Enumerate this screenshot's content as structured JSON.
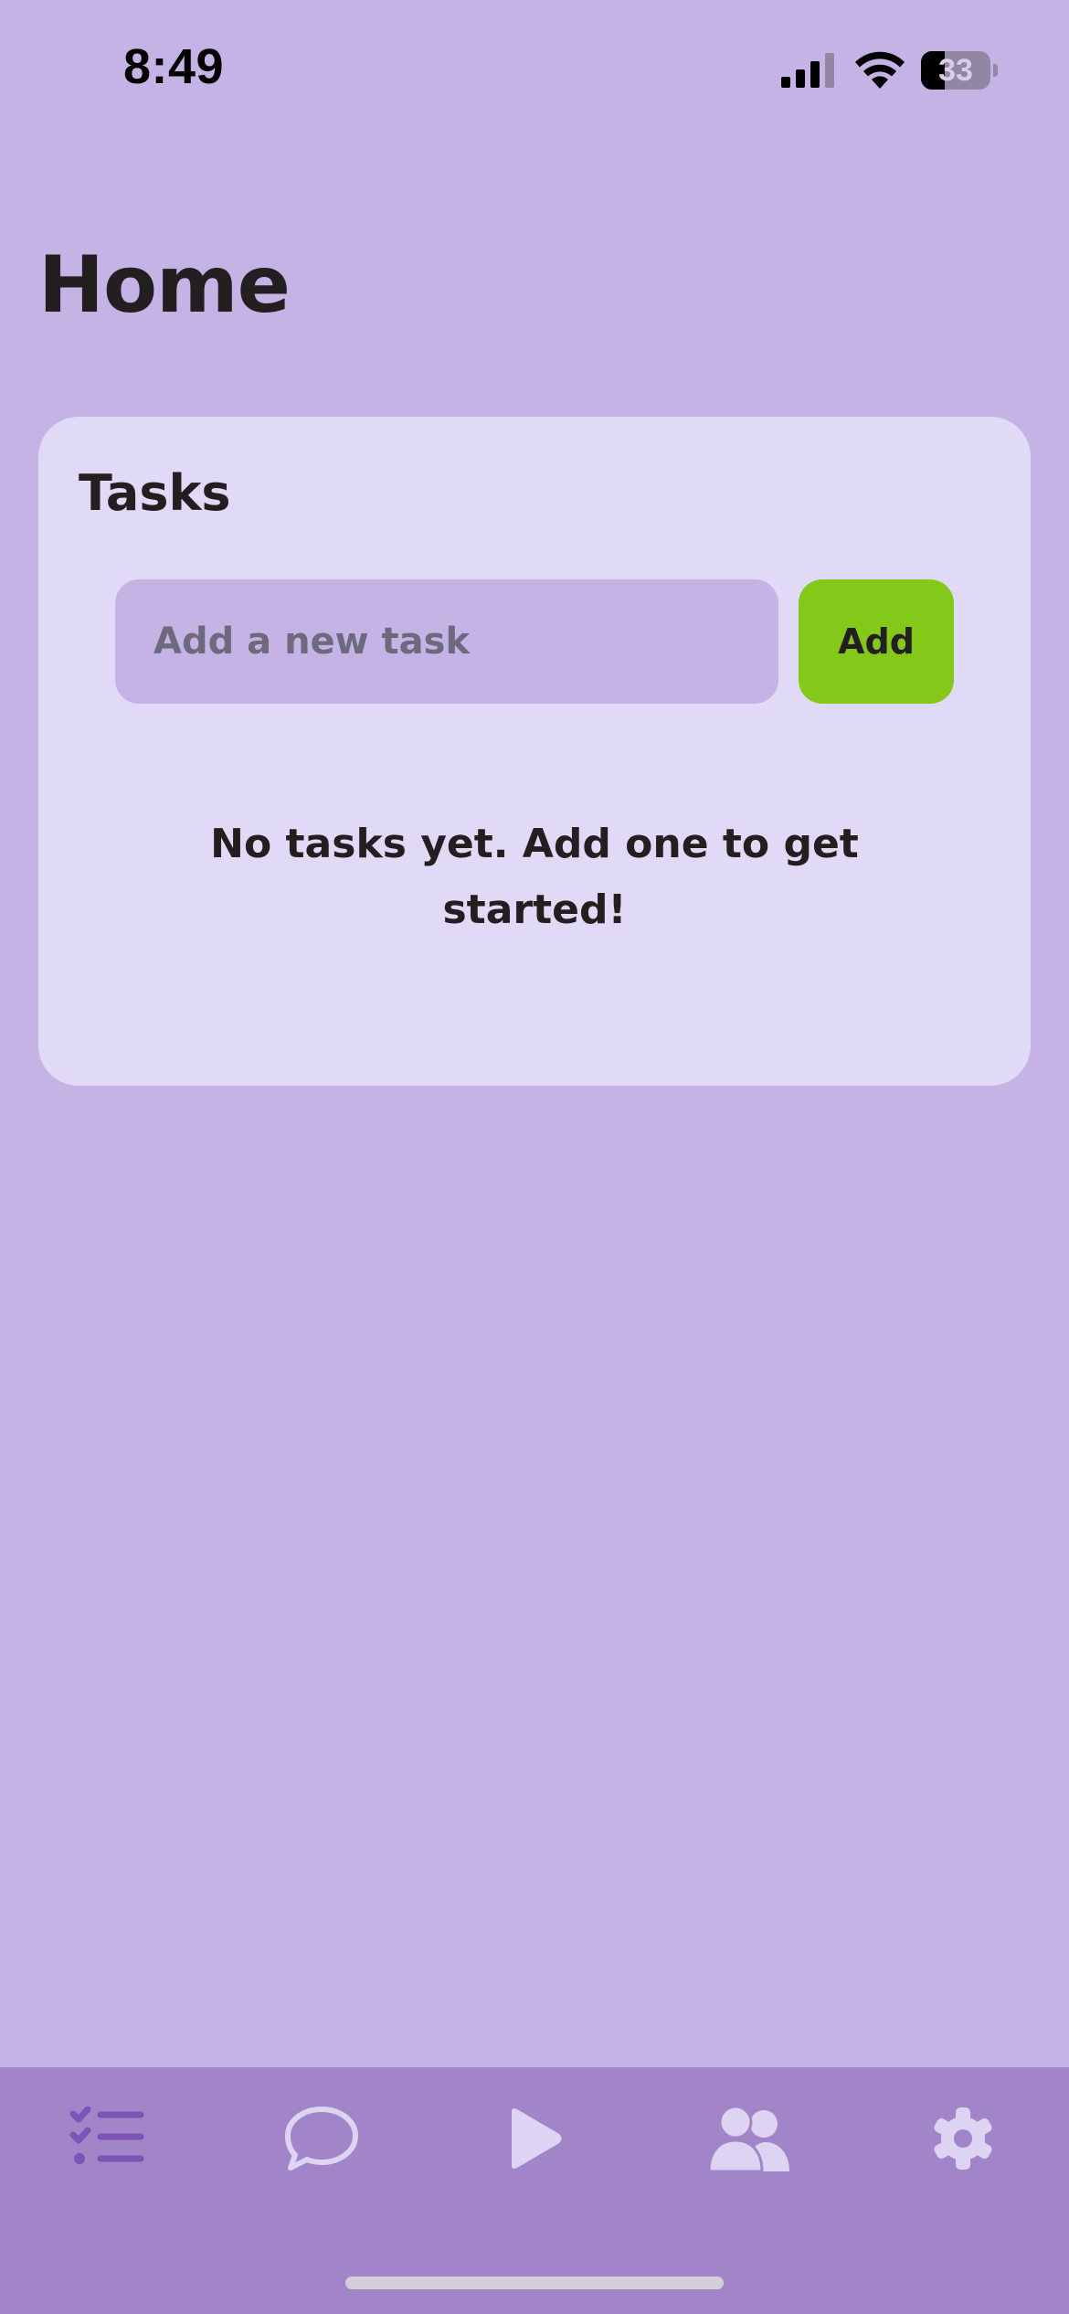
{
  "status_bar": {
    "time": "8:49",
    "battery_level": "33",
    "icons": [
      "signal-icon",
      "wifi-icon",
      "battery-icon"
    ]
  },
  "header": {
    "title": "Home"
  },
  "tasks_card": {
    "title": "Tasks",
    "input_placeholder": "Add a new task",
    "input_value": "",
    "add_label": "Add",
    "empty_message": "No tasks yet. Add one to get started!"
  },
  "tab_bar": {
    "items": [
      {
        "icon": "checklist-icon",
        "active": true
      },
      {
        "icon": "chat-bubble-icon",
        "active": false
      },
      {
        "icon": "play-icon",
        "active": false
      },
      {
        "icon": "people-icon",
        "active": false
      },
      {
        "icon": "gear-icon",
        "active": false
      }
    ]
  },
  "colors": {
    "background": "#c5b3e6",
    "card": "#e0daf7",
    "input": "#c5b3e6",
    "accent_button": "#84c819",
    "tab_bar": "#a185c8",
    "tab_icon_active": "#7b54b5",
    "tab_icon_inactive": "#ddd4f3",
    "text": "#231f20"
  }
}
